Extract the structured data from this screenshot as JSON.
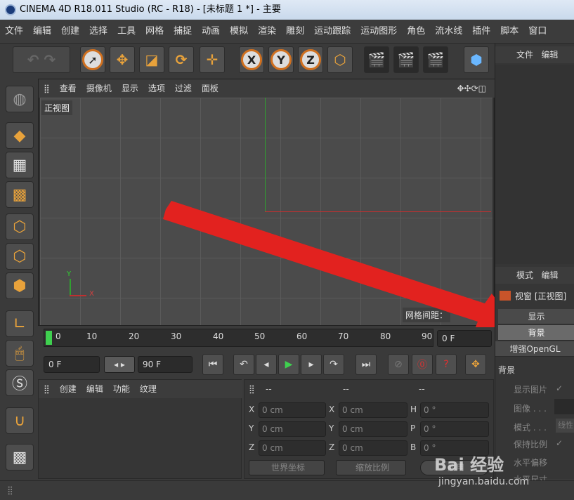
{
  "title": "CINEMA 4D R18.011 Studio (RC - R18) - [未标题 1 *] - 主要",
  "menu": [
    "文件",
    "编辑",
    "创建",
    "选择",
    "工具",
    "网格",
    "捕捉",
    "动画",
    "模拟",
    "渲染",
    "雕刻",
    "运动跟踪",
    "运动图形",
    "角色",
    "流水线",
    "插件",
    "脚本",
    "窗口"
  ],
  "toolbar_axes": [
    "X",
    "Y",
    "Z"
  ],
  "viewport": {
    "menu": [
      "查看",
      "摄像机",
      "显示",
      "选项",
      "过滤",
      "面板"
    ],
    "label": "正视图",
    "grid_spacing": "网格间距：",
    "axis_x": "X",
    "axis_y": "Y"
  },
  "timeline": {
    "ticks": [
      "0",
      "10",
      "20",
      "30",
      "40",
      "50",
      "60",
      "70",
      "80",
      "90"
    ],
    "current_frame": "0 F"
  },
  "playback": {
    "start": "0 F",
    "end": "90 F"
  },
  "object_panel": {
    "menu": [
      "创建",
      "编辑",
      "功能",
      "纹理"
    ]
  },
  "coord_panel": {
    "headers": [
      "--",
      "--",
      "--"
    ],
    "labels_pos": [
      "X",
      "Y",
      "Z"
    ],
    "labels_size": [
      "X",
      "Y",
      "Z"
    ],
    "labels_rot": [
      "H",
      "P",
      "B"
    ],
    "value_cm": "0 cm",
    "value_deg": "0 °",
    "world_coords": "世界坐标",
    "scale_ratio": "缩放比例",
    "apply": "应用"
  },
  "right_panel": {
    "top_menu": [
      "文件",
      "编辑"
    ],
    "attr_menu": [
      "模式",
      "编辑"
    ],
    "viewport_title": "视窗 [正视图]",
    "tabs": [
      "显示",
      "背景",
      "增强OpenGL"
    ],
    "section": "背景",
    "props": [
      "显示图片",
      "图像 . . .",
      "模式 . . .",
      "保持比例",
      "水平偏移",
      "水平尺寸"
    ],
    "mode_value": "线性"
  },
  "watermark": "Bai 经验",
  "watermark_url": "jingyan.baidu.com",
  "colors": {
    "accent": "#d0701f",
    "arrow": "#e2221f",
    "axis_x": "#c03030",
    "axis_y": "#30a030"
  }
}
